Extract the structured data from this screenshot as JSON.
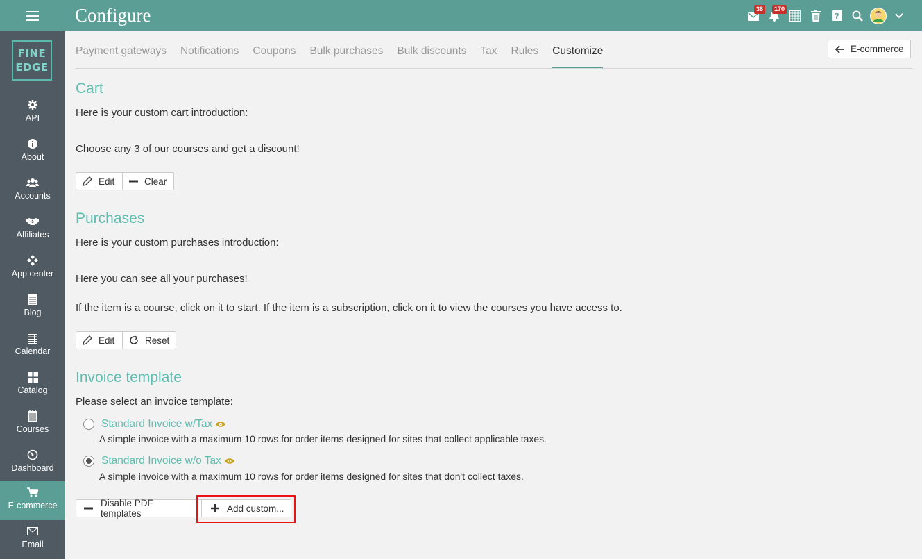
{
  "header": {
    "title": "Configure",
    "inbox_badge": "38",
    "notifications_badge": "170",
    "icons": [
      "inbox-icon",
      "bell-icon",
      "calendar-grid-icon",
      "trash-icon",
      "help-icon",
      "search-icon",
      "avatar",
      "chevron-down-icon"
    ]
  },
  "logo": {
    "line1": "FINE",
    "line2": "EDGE"
  },
  "sidebar": {
    "items": [
      {
        "label": "API",
        "icon": "gear-icon"
      },
      {
        "label": "About",
        "icon": "info-icon"
      },
      {
        "label": "Accounts",
        "icon": "users-icon"
      },
      {
        "label": "Affiliates",
        "icon": "handshake-icon"
      },
      {
        "label": "App center",
        "icon": "apps-icon"
      },
      {
        "label": "Blog",
        "icon": "blog-icon"
      },
      {
        "label": "Calendar",
        "icon": "calendar-icon"
      },
      {
        "label": "Catalog",
        "icon": "catalog-icon"
      },
      {
        "label": "Courses",
        "icon": "courses-icon"
      },
      {
        "label": "Dashboard",
        "icon": "dashboard-icon"
      },
      {
        "label": "E-commerce",
        "icon": "cart-icon",
        "active": true
      },
      {
        "label": "Email",
        "icon": "email-icon"
      }
    ]
  },
  "tabs": [
    "Payment gateways",
    "Notifications",
    "Coupons",
    "Bulk purchases",
    "Bulk discounts",
    "Tax",
    "Rules",
    "Customize"
  ],
  "active_tab": "Customize",
  "back_button": {
    "label": "E-commerce"
  },
  "cart": {
    "heading": "Cart",
    "intro": "Here is your custom cart introduction:",
    "text": "Choose any 3 of our courses and get a discount!",
    "edit_label": "Edit",
    "clear_label": "Clear"
  },
  "purchases": {
    "heading": "Purchases",
    "intro": "Here is your custom purchases introduction:",
    "text1": "Here you can see all your purchases!",
    "text2": "If the item is a course, click on it to start. If the item is a subscription, click on it to view the courses you have access to.",
    "edit_label": "Edit",
    "reset_label": "Reset"
  },
  "invoice": {
    "heading": "Invoice template",
    "intro": "Please select an invoice template:",
    "options": [
      {
        "title": "Standard Invoice w/Tax",
        "desc": "A simple invoice with a maximum 10 rows for order items designed for sites that collect applicable taxes.",
        "checked": false
      },
      {
        "title": "Standard Invoice w/o Tax",
        "desc": "A simple invoice with a maximum 10 rows for order items designed for sites that don't collect taxes.",
        "checked": true
      }
    ],
    "disable_label": "Disable PDF templates",
    "add_label": "Add custom..."
  },
  "colors": {
    "accent": "#5a9e95",
    "heading": "#5fbdb0",
    "sidebar": "#4f5a63",
    "badge": "#c9302c",
    "highlight": "#e11111"
  }
}
